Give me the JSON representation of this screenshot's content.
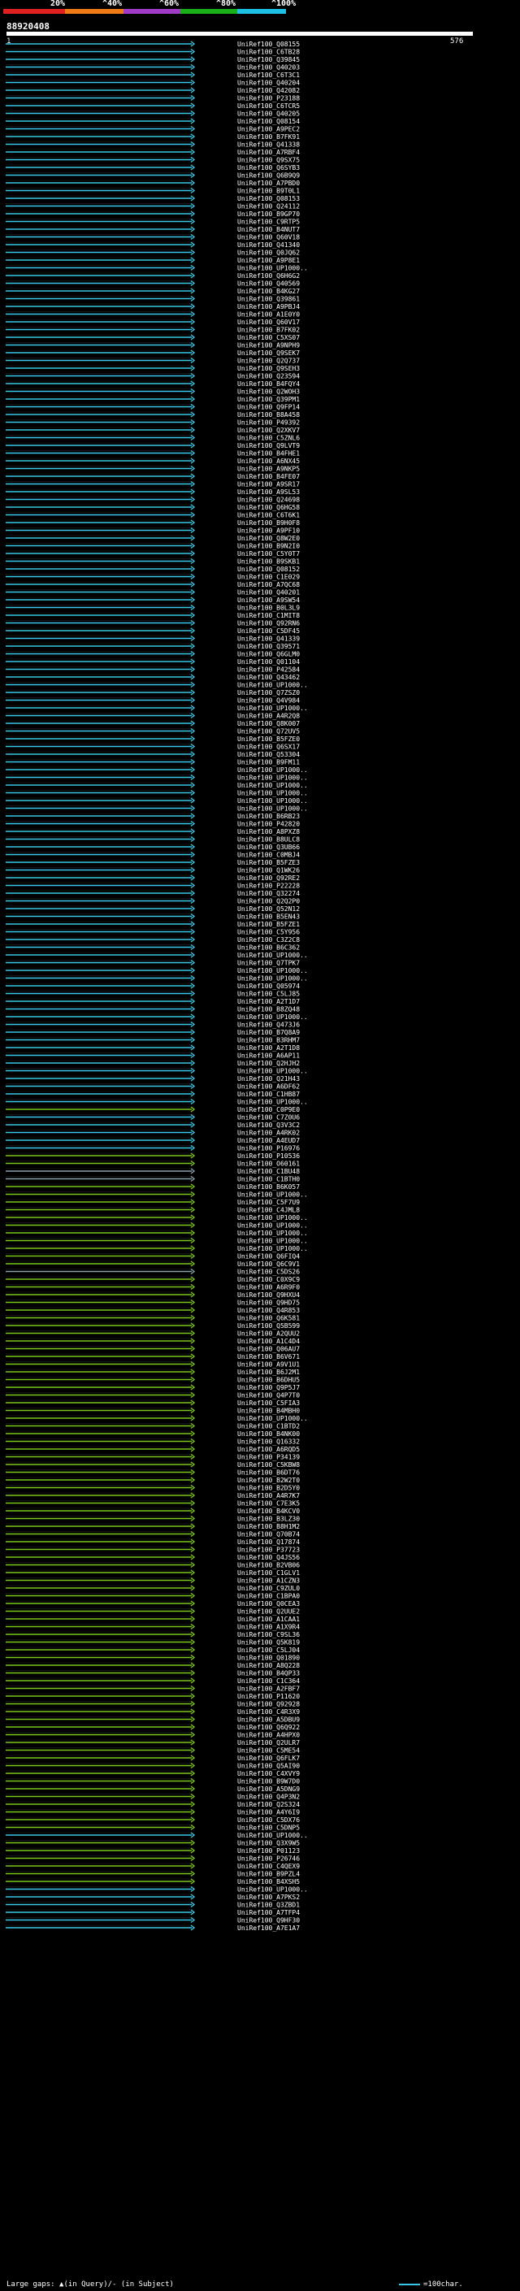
{
  "scale": {
    "ticks": [
      "20%",
      "^40%",
      "^60%",
      "^80%",
      "^100%"
    ],
    "bands": [
      {
        "color": "#e0201e"
      },
      {
        "color": "#f07b16"
      },
      {
        "color": "#a03cc8"
      },
      {
        "color": "#1ab01a"
      },
      {
        "color": "#1ec0e6"
      }
    ]
  },
  "query": {
    "id": "88920408",
    "start": "1",
    "end": "576"
  },
  "colors": {
    "cyan": "#39c7e6",
    "green": "#7ac61b",
    "gray": "#8aa0a8",
    "dark": "#444"
  },
  "hits": [
    {
      "label": "UniRef100_Q08155",
      "color": "cyan"
    },
    {
      "label": "UniRef100_C6TB28",
      "color": "cyan"
    },
    {
      "label": "UniRef100_Q39845",
      "color": "cyan"
    },
    {
      "label": "UniRef100_Q40203",
      "color": "cyan"
    },
    {
      "label": "UniRef100_C6T3C1",
      "color": "cyan"
    },
    {
      "label": "UniRef100_Q40204",
      "color": "cyan"
    },
    {
      "label": "UniRef100_Q42082",
      "color": "cyan"
    },
    {
      "label": "UniRef100_P23188",
      "color": "cyan"
    },
    {
      "label": "UniRef100_C6TCR5",
      "color": "cyan"
    },
    {
      "label": "UniRef100_Q40205",
      "color": "cyan"
    },
    {
      "label": "UniRef100_Q08154",
      "color": "cyan"
    },
    {
      "label": "UniRef100_A9PEC2",
      "color": "cyan"
    },
    {
      "label": "UniRef100_B7FK91",
      "color": "cyan"
    },
    {
      "label": "UniRef100_Q41338",
      "color": "cyan"
    },
    {
      "label": "UniRef100_A7RBF4",
      "color": "cyan"
    },
    {
      "label": "UniRef100_Q9SX75",
      "color": "cyan"
    },
    {
      "label": "UniRef100_Q6SYB3",
      "color": "cyan"
    },
    {
      "label": "UniRef100_Q6B9Q9",
      "color": "cyan"
    },
    {
      "label": "UniRef100_A7PBD0",
      "color": "cyan"
    },
    {
      "label": "UniRef100_B9T0L1",
      "color": "cyan"
    },
    {
      "label": "UniRef100_Q08153",
      "color": "cyan"
    },
    {
      "label": "UniRef100_Q24112",
      "color": "cyan"
    },
    {
      "label": "UniRef100_B9GP70",
      "color": "cyan"
    },
    {
      "label": "UniRef100_C9RTP5",
      "color": "cyan"
    },
    {
      "label": "UniRef100_B4NUT7",
      "color": "cyan"
    },
    {
      "label": "UniRef100_Q60V18",
      "color": "cyan"
    },
    {
      "label": "UniRef100_Q41340",
      "color": "cyan"
    },
    {
      "label": "UniRef100_Q0JQ62",
      "color": "cyan"
    },
    {
      "label": "UniRef100_A9P8E1",
      "color": "cyan"
    },
    {
      "label": "UniRef100_UP1000..",
      "color": "cyan"
    },
    {
      "label": "UniRef100_Q6H6G2",
      "color": "cyan"
    },
    {
      "label": "UniRef100_Q40569",
      "color": "cyan"
    },
    {
      "label": "UniRef100_B4KG27",
      "color": "cyan"
    },
    {
      "label": "UniRef100_Q39861",
      "color": "cyan"
    },
    {
      "label": "UniRef100_A9PBJ4",
      "color": "cyan"
    },
    {
      "label": "UniRef100_A1E0Y0",
      "color": "cyan"
    },
    {
      "label": "UniRef100_Q60V17",
      "color": "cyan"
    },
    {
      "label": "UniRef100_B7FK02",
      "color": "cyan"
    },
    {
      "label": "UniRef100_C5XS07",
      "color": "cyan"
    },
    {
      "label": "UniRef100_A9NPH9",
      "color": "cyan"
    },
    {
      "label": "UniRef100_Q9SEK7",
      "color": "cyan"
    },
    {
      "label": "UniRef100_Q2Q737",
      "color": "cyan"
    },
    {
      "label": "UniRef100_Q9SEH3",
      "color": "cyan"
    },
    {
      "label": "UniRef100_Q23594",
      "color": "cyan"
    },
    {
      "label": "UniRef100_B4FQY4",
      "color": "cyan"
    },
    {
      "label": "UniRef100_Q2WOH3",
      "color": "cyan"
    },
    {
      "label": "UniRef100_Q39PM1",
      "color": "cyan"
    },
    {
      "label": "UniRef100_Q9FP14",
      "color": "cyan"
    },
    {
      "label": "UniRef100_B8A458",
      "color": "cyan"
    },
    {
      "label": "UniRef100_P49392",
      "color": "cyan"
    },
    {
      "label": "UniRef100_Q2XKV7",
      "color": "cyan"
    },
    {
      "label": "UniRef100_C5ZNL6",
      "color": "cyan"
    },
    {
      "label": "UniRef100_Q9LVT9",
      "color": "cyan"
    },
    {
      "label": "UniRef100_B4FHE1",
      "color": "cyan"
    },
    {
      "label": "UniRef100_A6NX45",
      "color": "cyan"
    },
    {
      "label": "UniRef100_A9NKP5",
      "color": "cyan"
    },
    {
      "label": "UniRef100_B4FE07",
      "color": "cyan"
    },
    {
      "label": "UniRef100_A9SR17",
      "color": "cyan"
    },
    {
      "label": "UniRef100_A9SL53",
      "color": "cyan"
    },
    {
      "label": "UniRef100_Q24698",
      "color": "cyan"
    },
    {
      "label": "UniRef100_Q6HG58",
      "color": "cyan"
    },
    {
      "label": "UniRef100_C6T6K1",
      "color": "cyan"
    },
    {
      "label": "UniRef100_B9H0F8",
      "color": "cyan"
    },
    {
      "label": "UniRef100_A9PF10",
      "color": "cyan"
    },
    {
      "label": "UniRef100_Q8W2E0",
      "color": "cyan"
    },
    {
      "label": "UniRef100_B9N2I0",
      "color": "cyan"
    },
    {
      "label": "UniRef100_C5Y0T7",
      "color": "cyan"
    },
    {
      "label": "UniRef100_B9SKB1",
      "color": "cyan"
    },
    {
      "label": "UniRef100_Q08152",
      "color": "cyan"
    },
    {
      "label": "UniRef100_C1E029",
      "color": "cyan"
    },
    {
      "label": "UniRef100_A7QC68",
      "color": "cyan"
    },
    {
      "label": "UniRef100_Q40201",
      "color": "cyan"
    },
    {
      "label": "UniRef100_A9SW54",
      "color": "cyan"
    },
    {
      "label": "UniRef100_B0L3L9",
      "color": "cyan"
    },
    {
      "label": "UniRef100_C1MIT8",
      "color": "cyan"
    },
    {
      "label": "UniRef100_Q92RN6",
      "color": "cyan"
    },
    {
      "label": "UniRef100_C5DF45",
      "color": "cyan"
    },
    {
      "label": "UniRef100_Q41339",
      "color": "cyan"
    },
    {
      "label": "UniRef100_Q39571",
      "color": "cyan"
    },
    {
      "label": "UniRef100_Q6GLM0",
      "color": "cyan"
    },
    {
      "label": "UniRef100_Q01104",
      "color": "cyan"
    },
    {
      "label": "UniRef100_P42584",
      "color": "cyan"
    },
    {
      "label": "UniRef100_Q43462",
      "color": "cyan"
    },
    {
      "label": "UniRef100_UP1000..",
      "color": "cyan"
    },
    {
      "label": "UniRef100_Q7ZSZ0",
      "color": "cyan"
    },
    {
      "label": "UniRef100_Q4V984",
      "color": "cyan"
    },
    {
      "label": "UniRef100_UP1000..",
      "color": "cyan"
    },
    {
      "label": "UniRef100_A4R2Q8",
      "color": "cyan"
    },
    {
      "label": "UniRef100_Q8K007",
      "color": "cyan"
    },
    {
      "label": "UniRef100_Q72UV5",
      "color": "cyan"
    },
    {
      "label": "UniRef100_B5FZE0",
      "color": "cyan"
    },
    {
      "label": "UniRef100_Q6SX17",
      "color": "cyan"
    },
    {
      "label": "UniRef100_Q53304",
      "color": "cyan"
    },
    {
      "label": "UniRef100_B9FM11",
      "color": "cyan"
    },
    {
      "label": "UniRef100_UP1000..",
      "color": "cyan"
    },
    {
      "label": "UniRef100_UP1000..",
      "color": "cyan"
    },
    {
      "label": "UniRef100_UP1000..",
      "color": "cyan"
    },
    {
      "label": "UniRef100_UP1000..",
      "color": "cyan"
    },
    {
      "label": "UniRef100_UP1000..",
      "color": "cyan"
    },
    {
      "label": "UniRef100_UP1000..",
      "color": "cyan"
    },
    {
      "label": "UniRef100_B6RB23",
      "color": "cyan"
    },
    {
      "label": "UniRef100_P42820",
      "color": "cyan"
    },
    {
      "label": "UniRef100_A8PXZ8",
      "color": "cyan"
    },
    {
      "label": "UniRef100_B8ULC8",
      "color": "cyan"
    },
    {
      "label": "UniRef100_Q3UB66",
      "color": "cyan"
    },
    {
      "label": "UniRef100_C0MBJ4",
      "color": "cyan"
    },
    {
      "label": "UniRef100_B5FZE3",
      "color": "cyan"
    },
    {
      "label": "UniRef100_Q1WK26",
      "color": "cyan"
    },
    {
      "label": "UniRef100_Q92RE2",
      "color": "cyan"
    },
    {
      "label": "UniRef100_P22228",
      "color": "cyan"
    },
    {
      "label": "UniRef100_Q32274",
      "color": "cyan"
    },
    {
      "label": "UniRef100_Q2Q2P0",
      "color": "cyan"
    },
    {
      "label": "UniRef100_Q52N12",
      "color": "cyan"
    },
    {
      "label": "UniRef100_B5EN43",
      "color": "cyan"
    },
    {
      "label": "UniRef100_B5FZE1",
      "color": "cyan"
    },
    {
      "label": "UniRef100_C5Y956",
      "color": "cyan"
    },
    {
      "label": "UniRef100_C3Z2C8",
      "color": "cyan"
    },
    {
      "label": "UniRef100_B6C362",
      "color": "cyan"
    },
    {
      "label": "UniRef100_UP1000..",
      "color": "cyan"
    },
    {
      "label": "UniRef100_Q7TPK7",
      "color": "cyan"
    },
    {
      "label": "UniRef100_UP1000..",
      "color": "cyan"
    },
    {
      "label": "UniRef100_UP1000..",
      "color": "cyan"
    },
    {
      "label": "UniRef100_Q05974",
      "color": "cyan"
    },
    {
      "label": "UniRef100_C5LJ85",
      "color": "cyan"
    },
    {
      "label": "UniRef100_A2T1D7",
      "color": "cyan"
    },
    {
      "label": "UniRef100_B8ZQ48",
      "color": "cyan"
    },
    {
      "label": "UniRef100_UP1000..",
      "color": "cyan"
    },
    {
      "label": "UniRef100_Q473J6",
      "color": "cyan"
    },
    {
      "label": "UniRef100_B7Q8A9",
      "color": "cyan"
    },
    {
      "label": "UniRef100_B3RHM7",
      "color": "cyan"
    },
    {
      "label": "UniRef100_A2T1D8",
      "color": "cyan"
    },
    {
      "label": "UniRef100_A6AP11",
      "color": "cyan"
    },
    {
      "label": "UniRef100_Q2HJH2",
      "color": "cyan"
    },
    {
      "label": "UniRef100_UP1000..",
      "color": "cyan"
    },
    {
      "label": "UniRef100_Q21H43",
      "color": "cyan"
    },
    {
      "label": "UniRef100_A6DF62",
      "color": "cyan"
    },
    {
      "label": "UniRef100_C1HB87",
      "color": "cyan"
    },
    {
      "label": "UniRef100_UP1000..",
      "color": "cyan"
    },
    {
      "label": "UniRef100_C0P9E0",
      "color": "green"
    },
    {
      "label": "UniRef100_C7Z0U6",
      "color": "cyan"
    },
    {
      "label": "UniRef100_Q3V3C2",
      "color": "cyan"
    },
    {
      "label": "UniRef100_A4RK02",
      "color": "cyan"
    },
    {
      "label": "UniRef100_A4EUD7",
      "color": "cyan"
    },
    {
      "label": "UniRef100_P16976",
      "color": "cyan"
    },
    {
      "label": "UniRef100_P10536",
      "color": "green"
    },
    {
      "label": "UniRef100_O60161",
      "color": "green"
    },
    {
      "label": "UniRef100_C1BU48",
      "color": "gray"
    },
    {
      "label": "UniRef100_C1BTH0",
      "color": "gray"
    },
    {
      "label": "UniRef100_B6K057",
      "color": "green"
    },
    {
      "label": "UniRef100_UP1000..",
      "color": "green"
    },
    {
      "label": "UniRef100_C5F7U9",
      "color": "green"
    },
    {
      "label": "UniRef100_C4JML8",
      "color": "green"
    },
    {
      "label": "UniRef100_UP1000..",
      "color": "green"
    },
    {
      "label": "UniRef100_UP1000..",
      "color": "green"
    },
    {
      "label": "UniRef100_UP1000..",
      "color": "green"
    },
    {
      "label": "UniRef100_UP1000..",
      "color": "green"
    },
    {
      "label": "UniRef100_UP1000..",
      "color": "green"
    },
    {
      "label": "UniRef100_Q6FIQ4",
      "color": "green"
    },
    {
      "label": "UniRef100_Q6C9V1",
      "color": "green"
    },
    {
      "label": "UniRef100_C5DS26",
      "color": "gray"
    },
    {
      "label": "UniRef100_C0X9C9",
      "color": "green"
    },
    {
      "label": "UniRef100_A6R9F0",
      "color": "green"
    },
    {
      "label": "UniRef100_Q9HXU4",
      "color": "green"
    },
    {
      "label": "UniRef100_Q9HD75",
      "color": "green"
    },
    {
      "label": "UniRef100_Q4R853",
      "color": "green"
    },
    {
      "label": "UniRef100_Q6K581",
      "color": "green"
    },
    {
      "label": "UniRef100_Q5B599",
      "color": "green"
    },
    {
      "label": "UniRef100_A2QUU2",
      "color": "green"
    },
    {
      "label": "UniRef100_A1C4D4",
      "color": "green"
    },
    {
      "label": "UniRef100_Q06AU7",
      "color": "green"
    },
    {
      "label": "UniRef100_B6V671",
      "color": "green"
    },
    {
      "label": "UniRef100_A9V1U1",
      "color": "green"
    },
    {
      "label": "UniRef100_B6J2M1",
      "color": "green"
    },
    {
      "label": "UniRef100_B6DHU5",
      "color": "green"
    },
    {
      "label": "UniRef100_Q9P5J7",
      "color": "green"
    },
    {
      "label": "UniRef100_Q4P7T0",
      "color": "green"
    },
    {
      "label": "UniRef100_C5FIA3",
      "color": "green"
    },
    {
      "label": "UniRef100_B4MBH0",
      "color": "green"
    },
    {
      "label": "UniRef100_UP1000..",
      "color": "green"
    },
    {
      "label": "UniRef100_C1BTD2",
      "color": "green"
    },
    {
      "label": "UniRef100_B4NK00",
      "color": "green"
    },
    {
      "label": "UniRef100_Q16332",
      "color": "green"
    },
    {
      "label": "UniRef100_A6RQD5",
      "color": "green"
    },
    {
      "label": "UniRef100_P34139",
      "color": "green"
    },
    {
      "label": "UniRef100_C5KBW8",
      "color": "green"
    },
    {
      "label": "UniRef100_B6DT76",
      "color": "green"
    },
    {
      "label": "UniRef100_B2W2T0",
      "color": "green"
    },
    {
      "label": "UniRef100_B2D5Y0",
      "color": "green"
    },
    {
      "label": "UniRef100_A4R7K7",
      "color": "green"
    },
    {
      "label": "UniRef100_C7E3K5",
      "color": "green"
    },
    {
      "label": "UniRef100_B4KCV0",
      "color": "green"
    },
    {
      "label": "UniRef100_B3LZ30",
      "color": "green"
    },
    {
      "label": "UniRef100_B8H1M2",
      "color": "green"
    },
    {
      "label": "UniRef100_Q70B74",
      "color": "green"
    },
    {
      "label": "UniRef100_Q17874",
      "color": "green"
    },
    {
      "label": "UniRef100_P37723",
      "color": "green"
    },
    {
      "label": "UniRef100_Q4JS56",
      "color": "green"
    },
    {
      "label": "UniRef100_B2VB06",
      "color": "green"
    },
    {
      "label": "UniRef100_C1GLV1",
      "color": "green"
    },
    {
      "label": "UniRef100_A1CZN3",
      "color": "green"
    },
    {
      "label": "UniRef100_C9ZUL0",
      "color": "green"
    },
    {
      "label": "UniRef100_C1BPA0",
      "color": "green"
    },
    {
      "label": "UniRef100_Q0CEA3",
      "color": "green"
    },
    {
      "label": "UniRef100_Q2UUE2",
      "color": "green"
    },
    {
      "label": "UniRef100_A1CAA1",
      "color": "green"
    },
    {
      "label": "UniRef100_A1X9R4",
      "color": "green"
    },
    {
      "label": "UniRef100_C9SL36",
      "color": "green"
    },
    {
      "label": "UniRef100_Q5K819",
      "color": "green"
    },
    {
      "label": "UniRef100_C5LJ04",
      "color": "green"
    },
    {
      "label": "UniRef100_Q01890",
      "color": "green"
    },
    {
      "label": "UniRef100_A8Q228",
      "color": "green"
    },
    {
      "label": "UniRef100_B4QP33",
      "color": "green"
    },
    {
      "label": "UniRef100_C1C364",
      "color": "green"
    },
    {
      "label": "UniRef100_A2FBF7",
      "color": "green"
    },
    {
      "label": "UniRef100_P11620",
      "color": "green"
    },
    {
      "label": "UniRef100_Q92928",
      "color": "green"
    },
    {
      "label": "UniRef100_C4R3X9",
      "color": "green"
    },
    {
      "label": "UniRef100_A5DBU9",
      "color": "green"
    },
    {
      "label": "UniRef100_Q6Q922",
      "color": "green"
    },
    {
      "label": "UniRef100_A4HPX0",
      "color": "green"
    },
    {
      "label": "UniRef100_Q2ULR7",
      "color": "green"
    },
    {
      "label": "UniRef100_C5ME54",
      "color": "green"
    },
    {
      "label": "UniRef100_Q6FLK7",
      "color": "green"
    },
    {
      "label": "UniRef100_Q5AI90",
      "color": "green"
    },
    {
      "label": "UniRef100_C4XVY9",
      "color": "green"
    },
    {
      "label": "UniRef100_B9W7D0",
      "color": "green"
    },
    {
      "label": "UniRef100_A5DNG9",
      "color": "green"
    },
    {
      "label": "UniRef100_Q4P3N2",
      "color": "green"
    },
    {
      "label": "UniRef100_Q2S324",
      "color": "green"
    },
    {
      "label": "UniRef100_A4Y6I9",
      "color": "green"
    },
    {
      "label": "UniRef100_C5DX76",
      "color": "green"
    },
    {
      "label": "UniRef100_C5DNP5",
      "color": "green"
    },
    {
      "label": "UniRef100_UP1000..",
      "color": "cyan"
    },
    {
      "label": "UniRef100_Q3X9W5",
      "color": "green"
    },
    {
      "label": "UniRef100_P01123",
      "color": "green"
    },
    {
      "label": "UniRef100_P26746",
      "color": "green"
    },
    {
      "label": "UniRef100_C4QEX9",
      "color": "green"
    },
    {
      "label": "UniRef100_B9PZL4",
      "color": "green"
    },
    {
      "label": "UniRef100_B4XSH5",
      "color": "green"
    },
    {
      "label": "UniRef100_UP1000..",
      "color": "cyan"
    },
    {
      "label": "UniRef100_A7PKS2",
      "color": "cyan"
    },
    {
      "label": "UniRef100_Q3ZBD1",
      "color": "cyan"
    },
    {
      "label": "UniRef100_A7TFP4",
      "color": "cyan"
    },
    {
      "label": "UniRef100_Q9HF30",
      "color": "cyan"
    },
    {
      "label": "UniRef100_A7E1A7",
      "color": "cyan"
    }
  ],
  "footer": {
    "text": "Large gaps: ▲(in Query)/- (in Subject)",
    "legend": "=100char."
  }
}
